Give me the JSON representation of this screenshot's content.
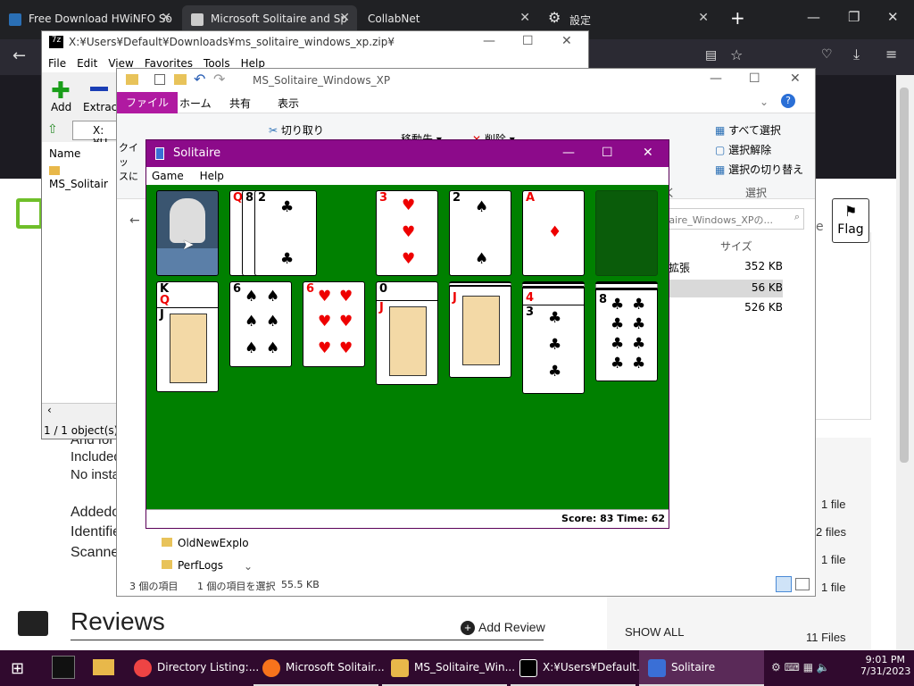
{
  "browser": {
    "tabs": [
      {
        "label": "Free Download HWiNFO So"
      },
      {
        "label": "Microsoft Solitaire and Sp"
      },
      {
        "label": "CollabNet"
      },
      {
        "label": "設定"
      }
    ]
  },
  "page": {
    "and_for": "And for",
    "included": "Included",
    "no_insta": "No insta",
    "added": "Addedo",
    "identifie": "Identifie",
    "scanne": "Scanne",
    "reviews": "Reviews",
    "add_review": "Add Review",
    "show_all": "SHOW ALL",
    "files_count": "11 Files",
    "flag": "Flag",
    "file_rows": [
      "1 file",
      "2 files",
      "1 file",
      "1 file"
    ]
  },
  "zip": {
    "title": "X:¥Users¥Default¥Downloads¥ms_solitaire_windows_xp.zip¥",
    "menu": [
      "File",
      "Edit",
      "View",
      "Favorites",
      "Tools",
      "Help"
    ],
    "tools": [
      "Add",
      "Extract"
    ],
    "path": "X:¥U",
    "col_name": "Name",
    "item": "MS_Solitair",
    "status": "1 / 1 object(s) s"
  },
  "explorer": {
    "title": "MS_Solitaire_Windows_XP",
    "tabs": [
      "ファイル",
      "ホーム",
      "共有",
      "表示"
    ],
    "cut": "切り取り",
    "move": "移動先",
    "delete": "削除",
    "select_all": "すべて選択",
    "deselect": "選択解除",
    "invert": "選択の切り替え",
    "select_group": "選択",
    "quick": "クイッ",
    "quick2": "スに",
    "search": "itaire_Windows_XPの...",
    "size_col": "サイズ",
    "ext": "ン拡張",
    "ext2": "ソ",
    "ext3": "ン",
    "sizes": [
      "352 KB",
      "56 KB",
      "526 KB"
    ],
    "tree": [
      "OldNewExplo",
      "PerfLogs"
    ],
    "status_items": "3 個の項目",
    "status_sel": "1 個の項目を選択",
    "status_size": "55.5 KB",
    "chk_label": "く"
  },
  "solitaire": {
    "title": "Solitaire",
    "menu": [
      "Game",
      "Help"
    ],
    "status": "Score: 83 Time: 62",
    "felt_color": "#008000"
  },
  "taskbar": {
    "items": [
      "Directory Listing:...",
      "Microsoft Solitair...",
      "MS_Solitaire_Win...",
      "X:¥Users¥Default...",
      "Solitaire"
    ],
    "time": "9:01 PM",
    "date": "7/31/2023"
  }
}
